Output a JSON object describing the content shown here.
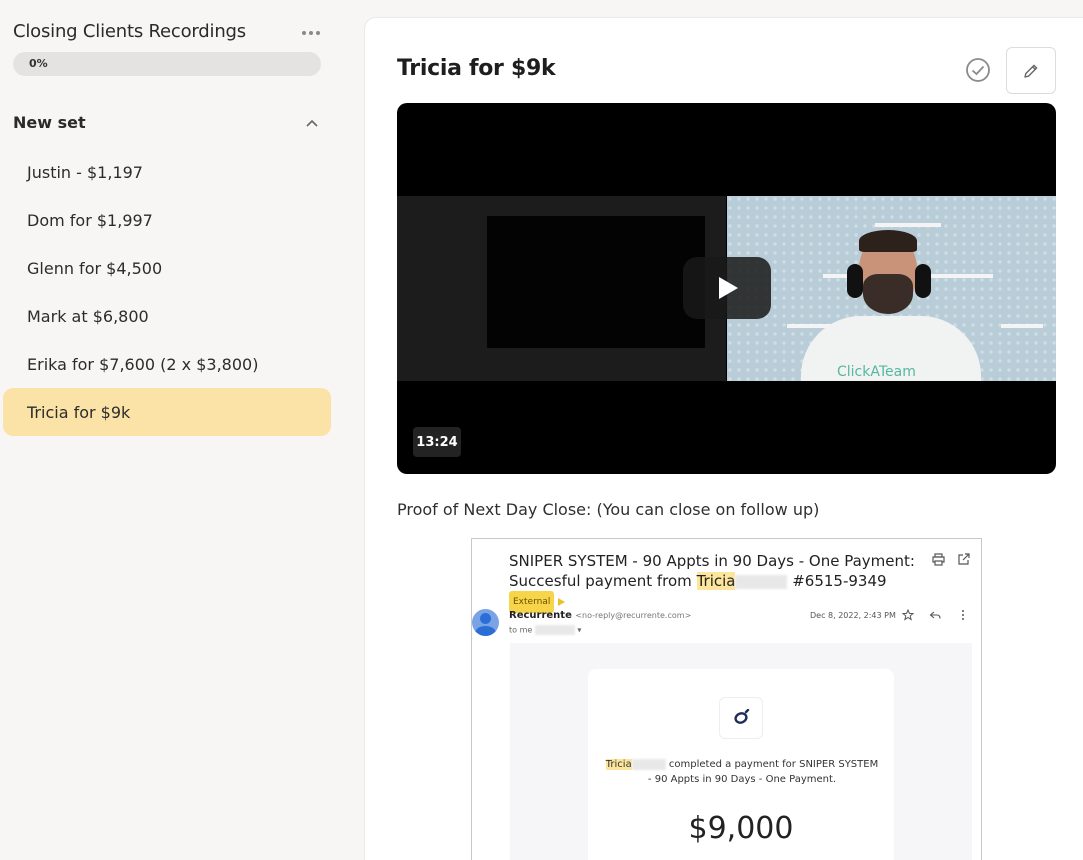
{
  "sidebar": {
    "course_title": "Closing Clients Recordings",
    "progress_label": "0%",
    "progress_value": 0,
    "section_title": "New set",
    "lessons": [
      {
        "label": "Justin - $1,197"
      },
      {
        "label": "Dom for $1,997"
      },
      {
        "label": "Glenn for $4,500"
      },
      {
        "label": "Mark at $6,800"
      },
      {
        "label": "Erika for $7,600 (2 x $3,800)"
      },
      {
        "label": "Tricia for $9k"
      }
    ],
    "active_lesson": "Tricia for $9k"
  },
  "main": {
    "title": "Tricia for $9k",
    "video": {
      "duration": "13:24",
      "shirt_text": "ClickATeam"
    },
    "description": "Proof of Next Day Close: (You can close on follow up)"
  },
  "email": {
    "subject_line1": "SNIPER SYSTEM - 90 Appts in 90 Days - One Payment:",
    "subject_prefix": "Succesful payment from ",
    "subject_name": "Tricia",
    "subject_suffix": " #6515-9349",
    "external_badge": "External",
    "sender_name": "Recurrente",
    "sender_email": "<no-reply@recurrente.com>",
    "to": "to me",
    "date": "Dec 8, 2022, 2:43 PM",
    "payer_name": "Tricia",
    "payment_text": " completed a payment for ",
    "product_name": "SNIPER SYSTEM",
    "product_rest": "- 90 Appts in 90 Days - One Payment.",
    "amount": "$9,000"
  },
  "colors": {
    "active_lesson_bg": "#fbe3a8",
    "highlight": "#fde59b",
    "external_badge": "#f8d44a"
  }
}
